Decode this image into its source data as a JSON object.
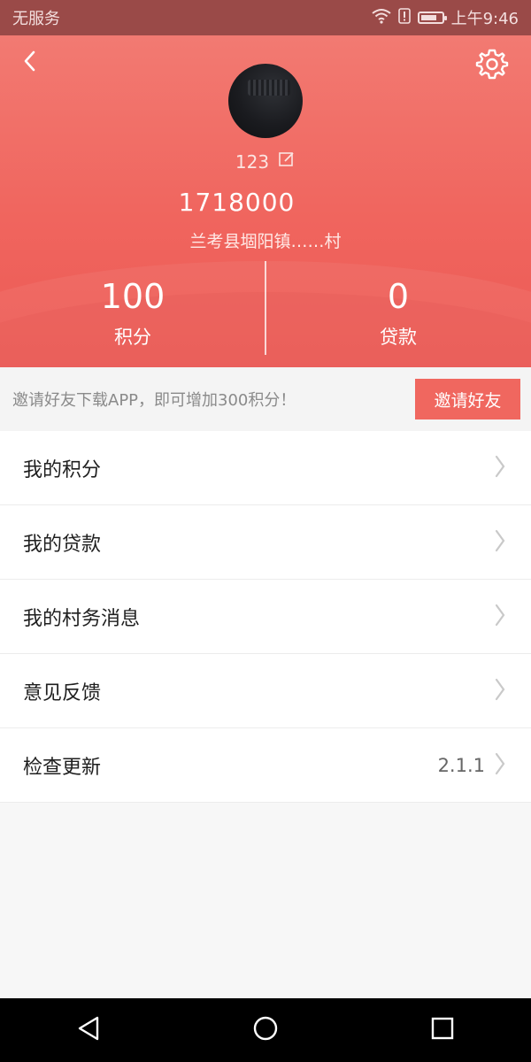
{
  "status_bar": {
    "carrier": "无服务",
    "time": "上午9:46",
    "battery_level": 0.75,
    "icons": [
      "wifi-icon",
      "alert-icon",
      "battery-icon"
    ]
  },
  "header": {
    "username": "123",
    "phone": "1718000",
    "address": "兰考县堌阳镇……村",
    "accent_color": "#f0655e",
    "icons": [
      "back-chevron-icon",
      "gear-icon",
      "edit-icon"
    ]
  },
  "stats": [
    {
      "value": "100",
      "label": "积分"
    },
    {
      "value": "0",
      "label": "贷款"
    }
  ],
  "invite": {
    "text": "邀请好友下载APP，即可增加300积分！",
    "button_label": "邀请好友"
  },
  "menu": {
    "items": [
      {
        "label": "我的积分"
      },
      {
        "label": "我的贷款"
      },
      {
        "label": "我的村务消息"
      },
      {
        "label": "意见反馈"
      },
      {
        "label": "检查更新",
        "value": "2.1.1"
      }
    ],
    "chevron_icon": "chevron-right-icon"
  },
  "nav_bar": {
    "icons": [
      "back-triangle-icon",
      "home-circle-icon",
      "recents-square-icon"
    ]
  }
}
